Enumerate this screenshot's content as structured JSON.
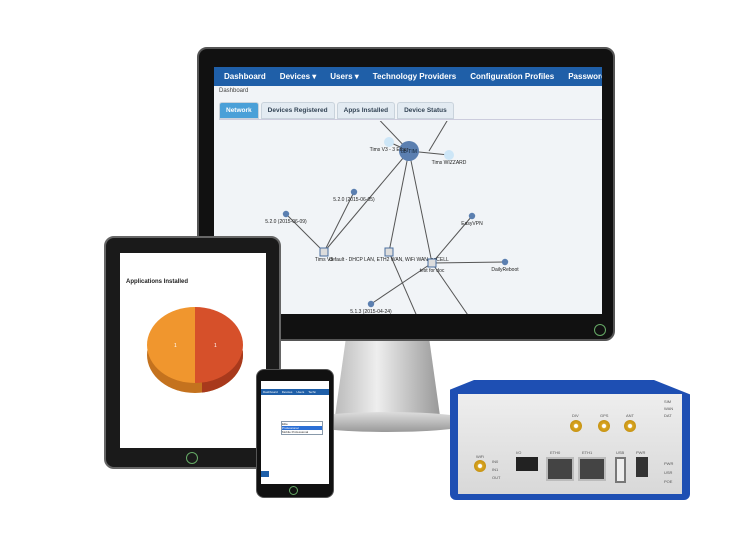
{
  "monitor": {
    "nav": [
      "Dashboard",
      "Devices ▾",
      "Users ▾",
      "Technology Providers",
      "Configuration Profiles",
      "Password ▾"
    ],
    "breadcrumb": "Dashboard",
    "tabs": [
      "Network",
      "Devices Registered",
      "Apps Installed",
      "Device Status"
    ],
    "graph": {
      "center": "bb-TIM",
      "nodes": [
        "5.2.1 (2015-07-14)",
        "Tims V3 - 3 Ether",
        "Tims WIZZARD",
        "5.2.0 (2015-06-05)",
        "5.2.0 (2015-06-09)",
        "EasyVPN",
        "Tims V3",
        "default - DHCP LAN, ETH2 WAN, WiFi WAN, noCELL",
        "DailyReboot",
        "test for doc",
        "5.1.3 (2015-04-24)"
      ],
      "node_color": "#5b7fb0"
    }
  },
  "tablet": {
    "title": "Applications Installed",
    "pie": {
      "values": [
        1,
        1
      ],
      "labels": [
        "1",
        "1"
      ],
      "colors": [
        "#f0962e",
        "#d6502a"
      ]
    }
  },
  "phone": {
    "nav": [
      "Dashboard",
      "Devices",
      "Users",
      "Techn"
    ],
    "options": [
      "Elite",
      "Professional",
      "Mobile Professional"
    ]
  },
  "router": {
    "antennas": [
      "DIV",
      "GPS",
      "ANT"
    ],
    "leds_right": [
      "SIM",
      "WAN",
      "DAT"
    ],
    "leds_bottom": [
      "PWR",
      "USR",
      "POE"
    ],
    "ports": [
      "ETH0",
      "ETH1",
      "USB",
      "PWR"
    ],
    "io": "I/O",
    "io_labels": [
      "IN0",
      "IN1",
      "OUT"
    ],
    "wifi": "WiFi"
  }
}
